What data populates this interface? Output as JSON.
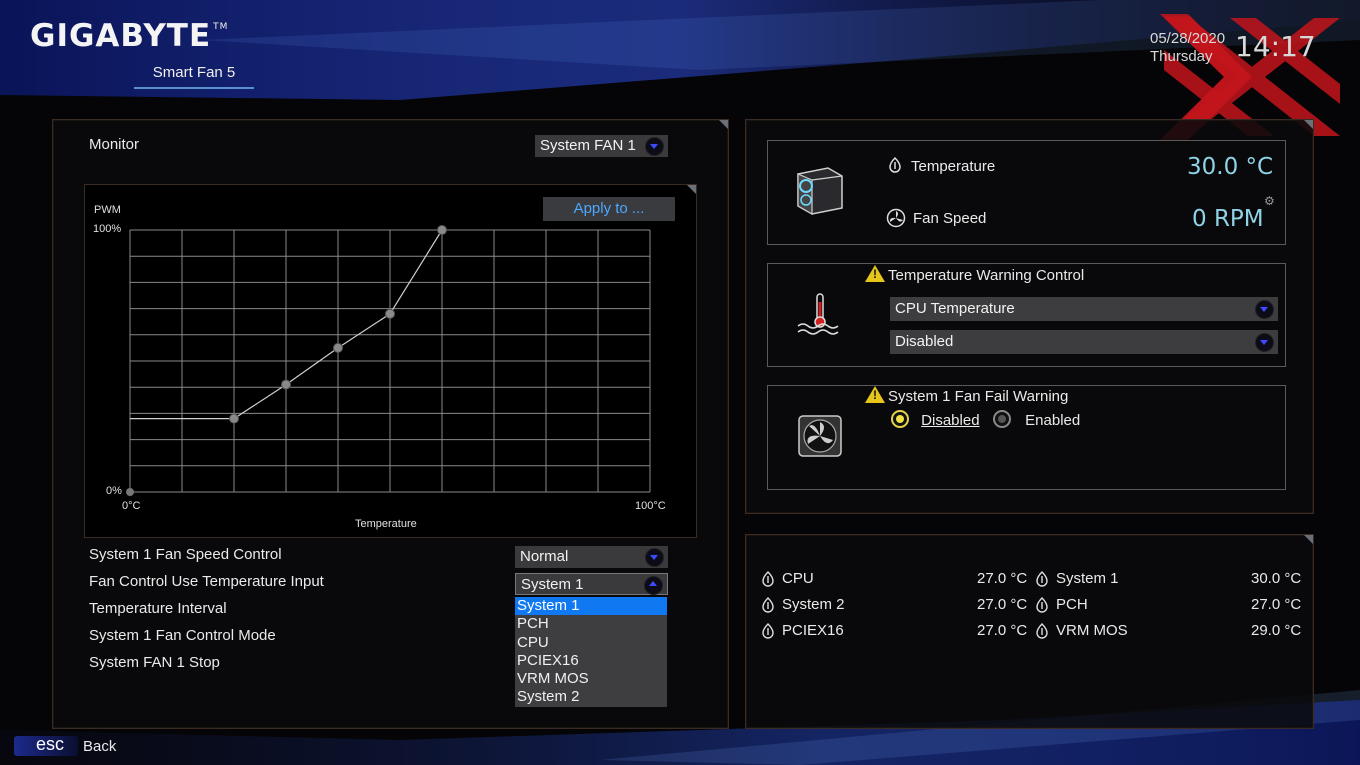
{
  "header": {
    "brand": "GIGABYTE",
    "trademark": "TM",
    "tab_label": "Smart Fan 5",
    "date": "05/28/2020",
    "weekday": "Thursday",
    "time": "14:17"
  },
  "left_panel": {
    "monitor_label": "Monitor",
    "monitor_select": "System FAN 1",
    "apply_button": "Apply to ...",
    "chart_data": {
      "type": "line",
      "ylabel": "PWM",
      "xlabel": "Temperature",
      "y_ticks": [
        "100%",
        "0%"
      ],
      "x_ticks": [
        "0°C",
        "100°C"
      ],
      "xlim": [
        0,
        100
      ],
      "ylim": [
        0,
        100
      ],
      "grid": true,
      "x": [
        0,
        20,
        30,
        40,
        50,
        60
      ],
      "y": [
        28,
        28,
        41,
        55,
        68,
        100
      ],
      "flat_segment_from": 0
    },
    "settings": [
      {
        "label": "System 1 Fan Speed Control",
        "value": "Normal"
      },
      {
        "label": "Fan Control Use Temperature Input",
        "value": "System 1"
      },
      {
        "label": "Temperature Interval"
      },
      {
        "label": "System 1 Fan Control Mode"
      },
      {
        "label": "System FAN 1 Stop"
      }
    ],
    "temp_input_options": [
      "System 1",
      "PCH",
      "CPU",
      "PCIEX16",
      "VRM MOS",
      "System 2"
    ],
    "temp_input_selected": "System 1"
  },
  "status_panel": {
    "temperature_label": "Temperature",
    "temperature_value": "30.0 °C",
    "fan_speed_label": "Fan Speed",
    "fan_speed_value": "0 RPM",
    "temp_warning_title": "Temperature Warning Control",
    "temp_warning_source": "CPU Temperature",
    "temp_warning_value": "Disabled",
    "fan_fail_title": "System 1 Fan Fail Warning",
    "fan_fail_options": [
      "Disabled",
      "Enabled"
    ],
    "fan_fail_selected": "Disabled"
  },
  "sensors": [
    {
      "name": "CPU",
      "value": "27.0 °C"
    },
    {
      "name": "System 1",
      "value": "30.0 °C"
    },
    {
      "name": "System 2",
      "value": "27.0 °C"
    },
    {
      "name": "PCH",
      "value": "27.0 °C"
    },
    {
      "name": "PCIEX16",
      "value": "27.0 °C"
    },
    {
      "name": "VRM MOS",
      "value": "29.0 °C"
    }
  ],
  "footer": {
    "esc_key": "esc",
    "back_label": "Back"
  },
  "colors": {
    "accent_blue": "#1079f2",
    "value_cyan": "#8fd3e6",
    "warning_yellow": "#e7c51a",
    "watermark_red": "#c0151c"
  }
}
